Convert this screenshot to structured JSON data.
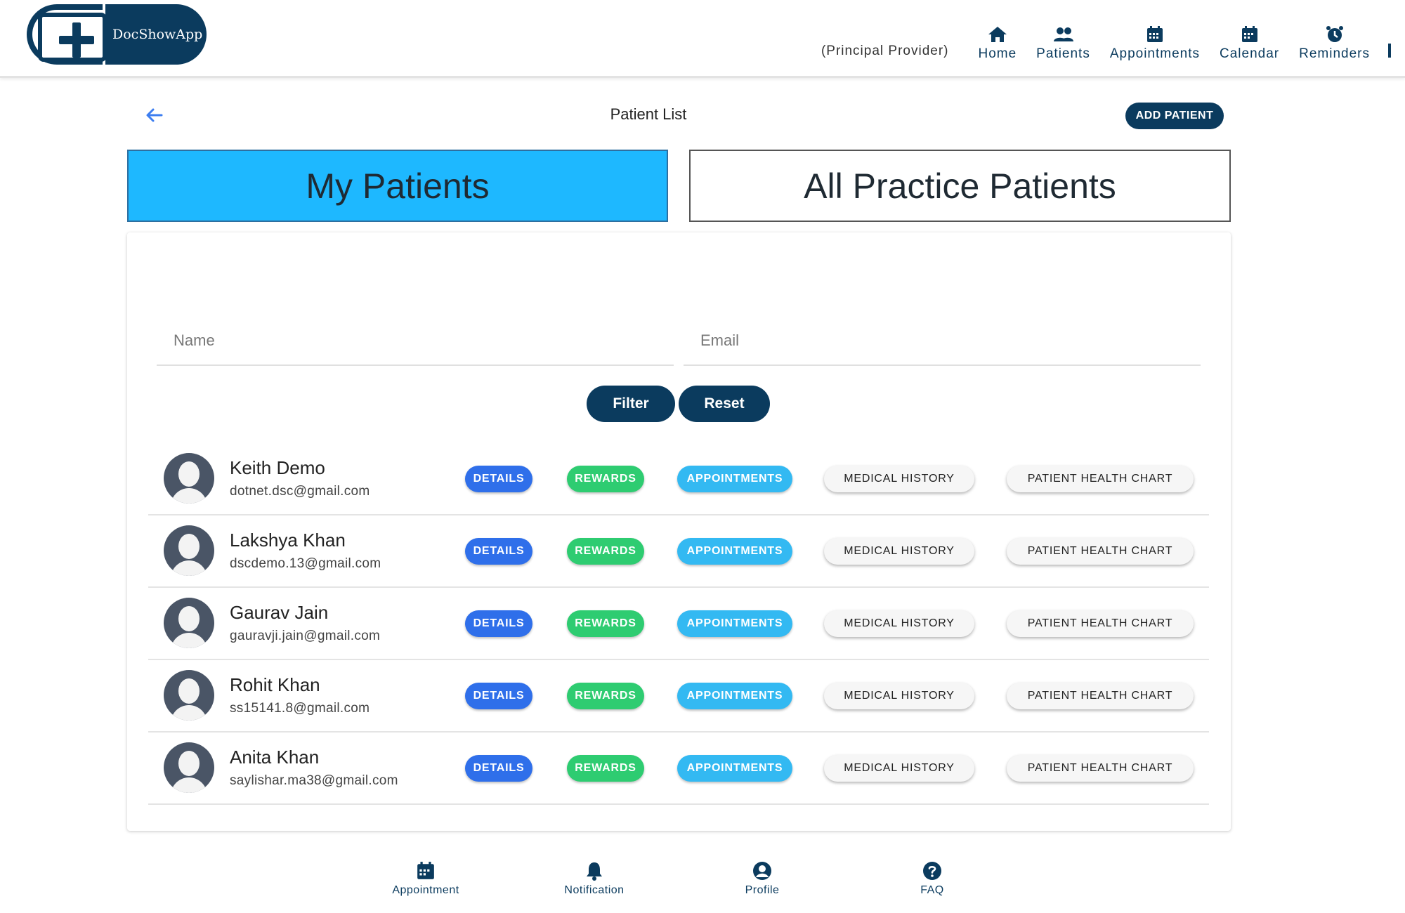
{
  "app": {
    "logo_text": "DocShowApp"
  },
  "nav": {
    "role": "(Principal Provider)",
    "items": [
      {
        "label": "Home",
        "icon": "home-icon"
      },
      {
        "label": "Patients",
        "icon": "patients-icon"
      },
      {
        "label": "Appointments",
        "icon": "calendar-grid-icon"
      },
      {
        "label": "Calendar",
        "icon": "calendar-icon"
      },
      {
        "label": "Reminders",
        "icon": "alarm-clock-icon"
      }
    ]
  },
  "page": {
    "title": "Patient List",
    "add_label": "ADD PATIENT"
  },
  "tabs": {
    "my": "My Patients",
    "all": "All Practice Patients"
  },
  "filters": {
    "name_placeholder": "Name",
    "email_placeholder": "Email",
    "filter_label": "Filter",
    "reset_label": "Reset"
  },
  "actions": {
    "details": "DETAILS",
    "rewards": "REWARDS",
    "appointments": "APPOINTMENTS",
    "medical_history": "MEDICAL HISTORY",
    "health_chart": "PATIENT HEALTH CHART"
  },
  "patients": [
    {
      "name": "Keith Demo",
      "email": "dotnet.dsc@gmail.com"
    },
    {
      "name": "Lakshya Khan",
      "email": "dscdemo.13@gmail.com"
    },
    {
      "name": "Gaurav Jain",
      "email": "gauravji.jain@gmail.com"
    },
    {
      "name": "Rohit Khan",
      "email": "ss15141.8@gmail.com"
    },
    {
      "name": "Anita Khan",
      "email": "saylishar.ma38@gmail.com"
    }
  ],
  "bottom_nav": [
    {
      "label": "Appointment",
      "icon": "calendar-icon"
    },
    {
      "label": "Notification",
      "icon": "bell-icon"
    },
    {
      "label": "Profile",
      "icon": "user-circle-icon"
    },
    {
      "label": "FAQ",
      "icon": "question-icon"
    }
  ],
  "colors": {
    "brand": "#0b3b5e",
    "tab_active": "#1eb8ff",
    "details": "#2f6fea",
    "rewards": "#2ecc71",
    "appointments": "#33b9f2"
  }
}
